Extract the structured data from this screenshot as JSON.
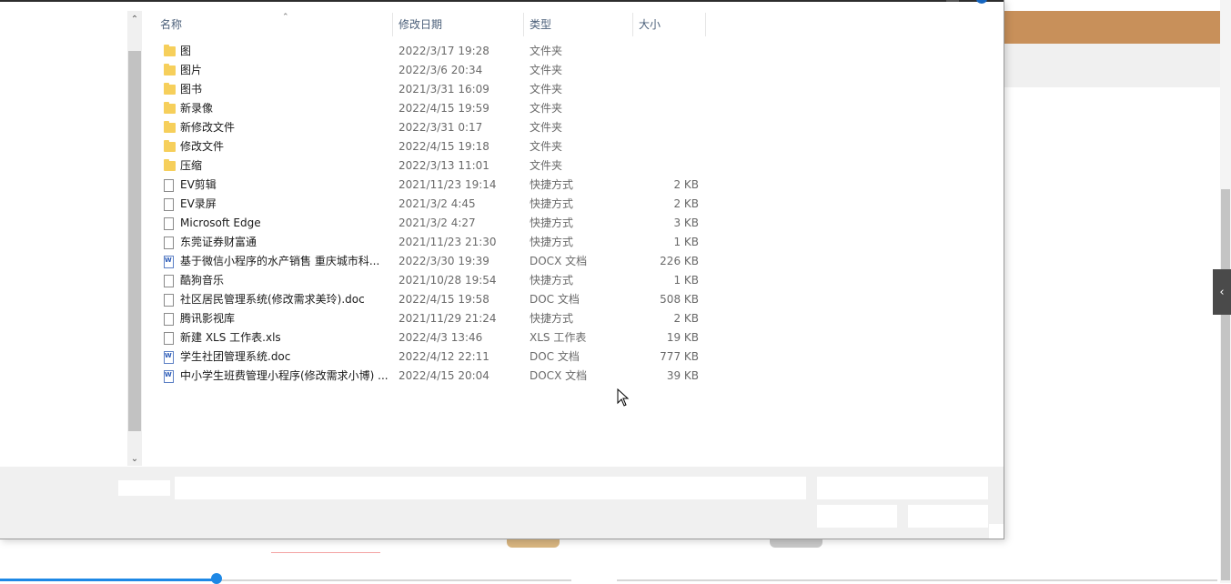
{
  "columns": {
    "name": "名称",
    "date": "修改日期",
    "type": "类型",
    "size": "大小"
  },
  "files": [
    {
      "name": "图",
      "date": "2022/3/17 19:28",
      "type": "文件夹",
      "size": "",
      "icon": "folder"
    },
    {
      "name": "图片",
      "date": "2022/3/6 20:34",
      "type": "文件夹",
      "size": "",
      "icon": "folder"
    },
    {
      "name": "图书",
      "date": "2021/3/31 16:09",
      "type": "文件夹",
      "size": "",
      "icon": "folder"
    },
    {
      "name": "新录像",
      "date": "2022/4/15 19:59",
      "type": "文件夹",
      "size": "",
      "icon": "folder"
    },
    {
      "name": "新修改文件",
      "date": "2022/3/31 0:17",
      "type": "文件夹",
      "size": "",
      "icon": "folder"
    },
    {
      "name": "修改文件",
      "date": "2022/4/15 19:18",
      "type": "文件夹",
      "size": "",
      "icon": "folder"
    },
    {
      "name": "压缩",
      "date": "2022/3/13 11:01",
      "type": "文件夹",
      "size": "",
      "icon": "folder"
    },
    {
      "name": "EV剪辑",
      "date": "2021/11/23 19:14",
      "type": "快捷方式",
      "size": "2 KB",
      "icon": "file"
    },
    {
      "name": "EV录屏",
      "date": "2021/3/2 4:45",
      "type": "快捷方式",
      "size": "2 KB",
      "icon": "file"
    },
    {
      "name": "Microsoft Edge",
      "date": "2021/3/2 4:27",
      "type": "快捷方式",
      "size": "3 KB",
      "icon": "file"
    },
    {
      "name": "东莞证券财富通",
      "date": "2021/11/23 21:30",
      "type": "快捷方式",
      "size": "1 KB",
      "icon": "file"
    },
    {
      "name": "基于微信小程序的水产销售 重庆城市科...",
      "date": "2022/3/30 19:39",
      "type": "DOCX 文档",
      "size": "226 KB",
      "icon": "word"
    },
    {
      "name": "酷狗音乐",
      "date": "2021/10/28 19:54",
      "type": "快捷方式",
      "size": "1 KB",
      "icon": "file"
    },
    {
      "name": "社区居民管理系统(修改需求美玲).doc",
      "date": "2022/4/15 19:58",
      "type": "DOC 文档",
      "size": "508 KB",
      "icon": "file"
    },
    {
      "name": "腾讯影视库",
      "date": "2021/11/29 21:24",
      "type": "快捷方式",
      "size": "2 KB",
      "icon": "file"
    },
    {
      "name": "新建 XLS 工作表.xls",
      "date": "2022/4/3 13:46",
      "type": "XLS 工作表",
      "size": "19 KB",
      "icon": "file"
    },
    {
      "name": "学生社团管理系统.doc",
      "date": "2022/4/12 22:11",
      "type": "DOC 文档",
      "size": "777 KB",
      "icon": "word"
    },
    {
      "name": "中小学生班费管理小程序(修改需求小博) ...",
      "date": "2022/4/15 20:04",
      "type": "DOCX 文档",
      "size": "39 KB",
      "icon": "word"
    }
  ],
  "colors": {
    "accent_orange": "#c8905a",
    "folder": "#f6cf5b",
    "progress": "#1e88e5"
  },
  "icons": {
    "sort": "sort-ascending-icon",
    "scroll_up": "scroll-up-icon",
    "scroll_down": "scroll-down-icon",
    "collapse": "chevron-left-icon"
  }
}
